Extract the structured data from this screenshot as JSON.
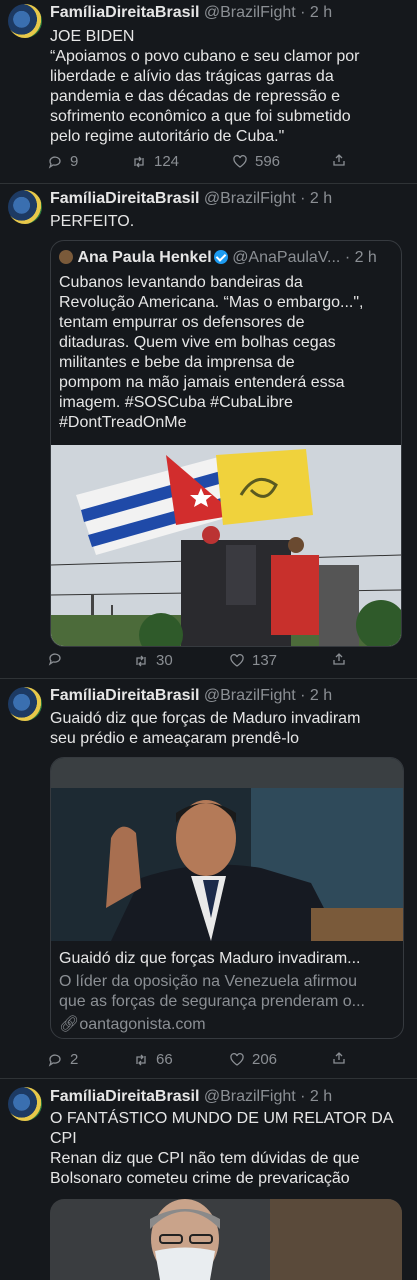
{
  "colors": {
    "background": "#15181c",
    "text": "#e6e6e6",
    "muted": "#8b8f94",
    "border": "#2f3336",
    "verified": "#1d9bf0"
  },
  "tweets": [
    {
      "name": "FamíliaDireitaBrasil",
      "handle": "@BrazilFight",
      "time": "· 2 h",
      "text_lines": [
        "JOE BIDEN",
        "“Apoiamos o povo cubano e seu clamor por",
        "liberdade e alívio das trágicas garras da",
        "pandemia e das décadas de repressão e",
        "sofrimento econômico a que foi submetido",
        "pelo regime autoritário de Cuba.\""
      ],
      "replies": "9",
      "retweets": "124",
      "likes": "596"
    },
    {
      "name": "FamíliaDireitaBrasil",
      "handle": "@BrazilFight",
      "time": "· 2 h",
      "text_lines": [
        "PERFEITO."
      ],
      "quote": {
        "name": "Ana Paula Henkel",
        "handle": "@AnaPaulaV...",
        "time": "· 2 h",
        "text_lines": [
          "Cubanos levantando bandeiras da",
          "Revolução Americana. “Mas o embargo...\",",
          "tentam empurrar os defensores de",
          "ditaduras. Quem vive em bolhas cegas",
          "militantes e bebe da imprensa de",
          "pompom na mão jamais entenderá essa",
          "imagem. #SOSCuba #CubaLibre",
          "#DontTreadOnMe"
        ]
      },
      "replies": "",
      "retweets": "30",
      "likes": "137"
    },
    {
      "name": "FamíliaDireitaBrasil",
      "handle": "@BrazilFight",
      "time": "· 2 h",
      "text_lines": [
        "Guaidó diz que forças de Maduro invadiram",
        "seu prédio e ameaçaram prendê-lo"
      ],
      "card": {
        "title": "Guaidó diz que forças Maduro invadiram...",
        "desc_lines": [
          "O líder da oposição na Venezuela afirmou",
          "que as forças de segurança prenderam o..."
        ],
        "link": "oantagonista.com"
      },
      "replies": "2",
      "retweets": "66",
      "likes": "206"
    },
    {
      "name": "FamíliaDireitaBrasil",
      "handle": "@BrazilFight",
      "time": "· 2 h",
      "text_lines": [
        "O FANTÁSTICO MUNDO DE UM RELATOR DA",
        "CPI",
        "Renan diz que CPI não tem dúvidas de que",
        "Bolsonaro cometeu crime de prevaricação"
      ]
    }
  ]
}
